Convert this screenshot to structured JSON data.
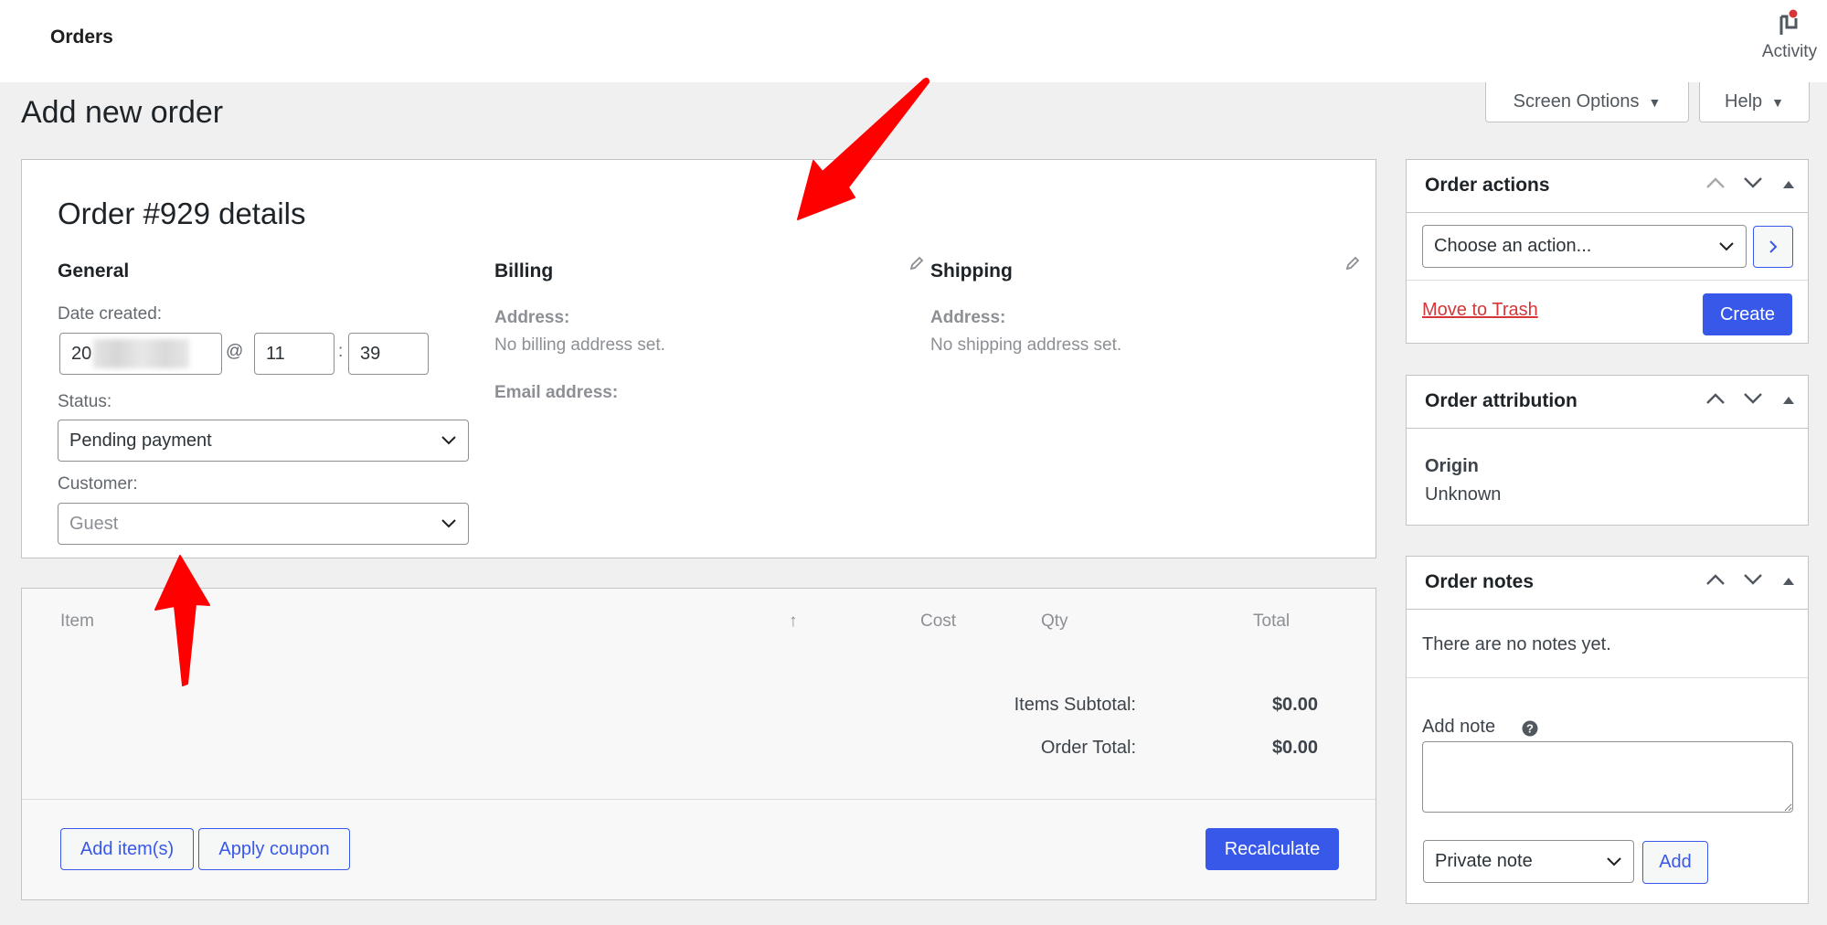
{
  "topbar": {
    "breadcrumb": "Orders",
    "activity_label": "Activity",
    "activity_icon": "flag-icon"
  },
  "screen_meta": {
    "screen_options_label": "Screen Options",
    "help_label": "Help"
  },
  "page": {
    "title": "Add new order"
  },
  "order": {
    "heading": "Order #929 details",
    "general": {
      "title": "General",
      "date_label": "Date created:",
      "date_value_visible": "20",
      "date_value_redacted": true,
      "at_sep": "@",
      "hour": "11",
      "time_sep": ":",
      "minute": "39",
      "status_label": "Status:",
      "status_value": "Pending payment",
      "customer_label": "Customer:",
      "customer_placeholder": "Guest"
    },
    "billing": {
      "title": "Billing",
      "address_label": "Address:",
      "address_value": "No billing address set.",
      "email_label": "Email address:"
    },
    "shipping": {
      "title": "Shipping",
      "address_label": "Address:",
      "address_value": "No shipping address set."
    }
  },
  "items": {
    "columns": [
      "Item",
      "↑",
      "Cost",
      "Qty",
      "Total"
    ],
    "subtotal_label": "Items Subtotal:",
    "subtotal_value": "$0.00",
    "order_total_label": "Order Total:",
    "order_total_value": "$0.00",
    "add_items_label": "Add item(s)",
    "apply_coupon_label": "Apply coupon",
    "recalculate_label": "Recalculate"
  },
  "sidebar": {
    "actions": {
      "title": "Order actions",
      "select_value": "Choose an action...",
      "apply_icon": "chevron-right-icon",
      "trash_label": "Move to Trash",
      "create_label": "Create"
    },
    "attribution": {
      "title": "Order attribution",
      "origin_label": "Origin",
      "origin_value": "Unknown"
    },
    "notes": {
      "title": "Order notes",
      "empty_text": "There are no notes yet.",
      "add_note_label": "Add note",
      "note_value": "",
      "note_type_value": "Private note",
      "add_button_label": "Add"
    }
  },
  "colors": {
    "accent": "#3858e9",
    "danger": "#d63638",
    "annotation_arrow": "#ff0000",
    "page_bg": "#f0f0f1",
    "activity_badge": "#d63638"
  }
}
